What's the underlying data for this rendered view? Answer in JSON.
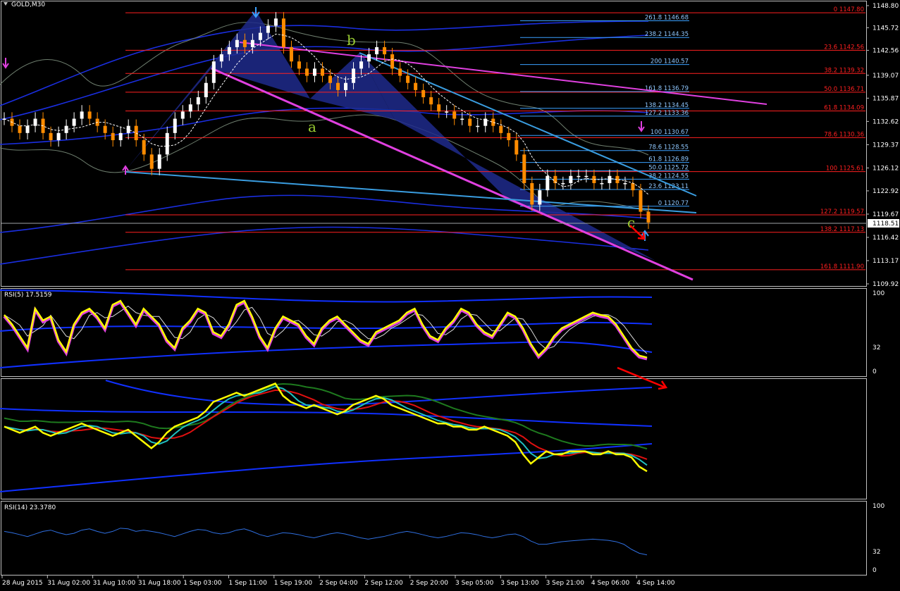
{
  "window": {
    "symbol_title": "GOLD,M30"
  },
  "colors": {
    "background": "#000000",
    "panel_border": "#c0c0c0",
    "price_axis_text": "#ffffff",
    "fib_red": "#ff2020",
    "fib_blue": "#3aa0ff",
    "pattern_fill": "#1e2a8c",
    "magenta_line": "#e040e0",
    "blue_trend": "#3a9de0",
    "rsi_yellow": "#ffff00",
    "band_blue": "#1030ff",
    "wave_label": "#9acd32",
    "red_arrow": "#ff0000"
  },
  "price_axis": {
    "ticks": [
      "1148.80",
      "1145.72",
      "1142.56",
      "1139.07",
      "1135.87",
      "1132.62",
      "1129.37",
      "1126.12",
      "1122.92",
      "1119.67",
      "1116.42",
      "1113.17",
      "1109.92"
    ],
    "current_price": "1118.51"
  },
  "time_axis": {
    "ticks": [
      "28 Aug 2015",
      "31 Aug 02:00",
      "31 Aug 10:00",
      "31 Aug 18:00",
      "1 Sep 03:00",
      "1 Sep 11:00",
      "1 Sep 19:00",
      "2 Sep 04:00",
      "2 Sep 12:00",
      "2 Sep 20:00",
      "3 Sep 05:00",
      "3 Sep 13:00",
      "3 Sep 21:00",
      "4 Sep 06:00",
      "4 Sep 14:00"
    ]
  },
  "fib_red_levels": [
    {
      "label": "0 1147.80"
    },
    {
      "label": "23.6 1142.56"
    },
    {
      "label": "38.2 1139.32"
    },
    {
      "label": "50.0 1136.71"
    },
    {
      "label": "61.8 1134.09"
    },
    {
      "label": "78.6 1130.36"
    },
    {
      "label": "100 1125.61"
    },
    {
      "label": "127.2 1119.57"
    },
    {
      "label": "138.2 1117.13"
    },
    {
      "label": "161.8 1111.90"
    }
  ],
  "fib_blue_levels": [
    {
      "label": "261.8 1146.68"
    },
    {
      "label": "238.2 1144.35"
    },
    {
      "label": "200 1140.57"
    },
    {
      "label": "161.8 1136.79"
    },
    {
      "label": "138.2 1134.45"
    },
    {
      "label": "127.2 1133.36"
    },
    {
      "label": "100 1130.67"
    },
    {
      "label": "78.6 1128.55"
    },
    {
      "label": "61.8 1126.89"
    },
    {
      "label": "50.0 1125.72"
    },
    {
      "label": "38.2 1124.55"
    },
    {
      "label": "23.6 1123.11"
    },
    {
      "label": "0 1120.77"
    }
  ],
  "wave_labels": {
    "a": "a",
    "b": "b",
    "c": "c"
  },
  "rsi5_panel": {
    "title": "RSI(5) 17.5159",
    "scale": [
      "100",
      "32",
      "0"
    ]
  },
  "rsi14_panel": {
    "title": "RSI(14) 23.3780",
    "scale": [
      "100",
      "32",
      "0"
    ]
  },
  "chart_data": {
    "type": "line",
    "title": "GOLD,M30",
    "price_close_approx": [
      1133,
      1132,
      1131,
      1132,
      1133,
      1131,
      1130,
      1131,
      1132,
      1133,
      1134,
      1133,
      1132,
      1131,
      1130,
      1131,
      1132,
      1130,
      1128,
      1126,
      1128,
      1131,
      1133,
      1134,
      1135,
      1136,
      1138,
      1141,
      1142,
      1143,
      1144,
      1143,
      1144,
      1145,
      1146,
      1147,
      1143,
      1141,
      1140,
      1139,
      1140,
      1139,
      1138,
      1137,
      1138,
      1140,
      1141,
      1142,
      1143,
      1142,
      1140,
      1139,
      1138,
      1137,
      1136,
      1135,
      1134,
      1134,
      1133,
      1133,
      1132,
      1132,
      1133,
      1132,
      1131,
      1130,
      1128,
      1124,
      1121,
      1123,
      1125,
      1124,
      1124,
      1125,
      1125,
      1125,
      1124,
      1124,
      1125,
      1124,
      1124,
      1123,
      1120,
      1118.5
    ],
    "rsi5_approx": [
      72,
      60,
      45,
      30,
      80,
      65,
      70,
      40,
      25,
      60,
      75,
      80,
      70,
      55,
      85,
      90,
      75,
      60,
      80,
      70,
      60,
      40,
      30,
      55,
      65,
      80,
      75,
      50,
      45,
      60,
      85,
      90,
      70,
      45,
      30,
      55,
      70,
      65,
      60,
      45,
      35,
      55,
      65,
      70,
      60,
      50,
      40,
      35,
      50,
      55,
      60,
      65,
      75,
      80,
      60,
      45,
      40,
      55,
      65,
      80,
      75,
      60,
      50,
      45,
      60,
      75,
      70,
      55,
      35,
      20,
      30,
      45,
      55,
      60,
      65,
      70,
      75,
      72,
      70,
      60,
      45,
      30,
      20,
      17.5
    ],
    "rsi14_approx": [
      60,
      58,
      55,
      52,
      56,
      60,
      62,
      58,
      55,
      57,
      62,
      64,
      60,
      57,
      60,
      65,
      64,
      60,
      62,
      60,
      58,
      55,
      52,
      56,
      60,
      63,
      62,
      58,
      56,
      58,
      62,
      64,
      60,
      55,
      52,
      55,
      58,
      57,
      55,
      52,
      50,
      53,
      56,
      58,
      56,
      53,
      50,
      48,
      50,
      52,
      55,
      58,
      60,
      58,
      55,
      52,
      50,
      52,
      55,
      58,
      57,
      55,
      52,
      50,
      52,
      55,
      56,
      52,
      45,
      40,
      40,
      42,
      44,
      45,
      46,
      47,
      48,
      47,
      46,
      44,
      40,
      32,
      26,
      23.4
    ]
  }
}
